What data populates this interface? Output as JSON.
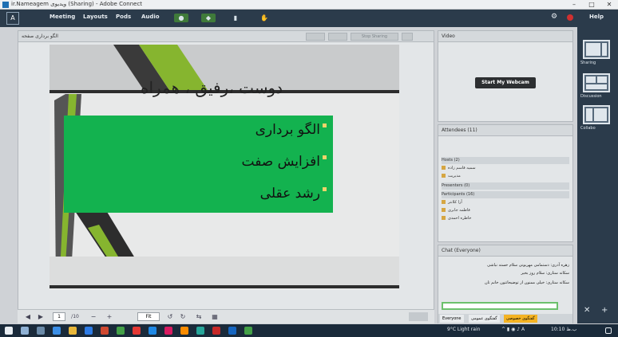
{
  "window": {
    "title": "ir.Nameagem ویدیوی (Sharing) - Adobe Connect"
  },
  "menu": {
    "items": [
      "Meeting",
      "Layouts",
      "Pods",
      "Audio"
    ],
    "help": "Help"
  },
  "share_pod": {
    "title": "الگو برداری صفحه",
    "header_buttons": [
      "Stop Sharing"
    ],
    "slide": {
      "title": "دوست ،رفیق ، همراه",
      "bullets": [
        "الگو برداری",
        "افزایش صفت",
        "رشد عقلی"
      ]
    },
    "toolbar": {
      "page": "1",
      "page_total": "/10",
      "zoom": "Fit"
    }
  },
  "video_pod": {
    "title": "Video",
    "webcam_button": "Start My Webcam"
  },
  "attendee_pod": {
    "title": "Attendees (11)",
    "rows": [
      {
        "type": "section",
        "label": "Hosts (2)"
      },
      {
        "type": "user",
        "label": "سمیه قاسم زاده"
      },
      {
        "type": "user",
        "label": "مدیریت"
      },
      {
        "type": "section",
        "label": "Presenters (0)"
      },
      {
        "type": "section",
        "label": "Participants (16)"
      },
      {
        "type": "user",
        "label": "آرا کلانتر"
      },
      {
        "type": "user",
        "label": "فاطمه جابری"
      },
      {
        "type": "user",
        "label": "خاطره احمدی"
      }
    ]
  },
  "chat_pod": {
    "title": "Chat (Everyone)",
    "lines": [
      "زهره آذری: دستمامی مهربونی سلام خسته نباشی",
      "سکانه ستاری: سلام روز بخیر",
      "سکانه ستاری: خیلی ممنون از توضیحاتتون خانم تان"
    ],
    "tabs": [
      "Everyone",
      "گفتگوی عمومی",
      "گفتگوی خصوصی"
    ]
  },
  "layouts_rail": {
    "items": [
      "Sharing",
      "Discussion",
      "Collabo"
    ]
  },
  "taskbar": {
    "weather": "9°C Light rain",
    "time": "10:10 ب.ظ"
  }
}
